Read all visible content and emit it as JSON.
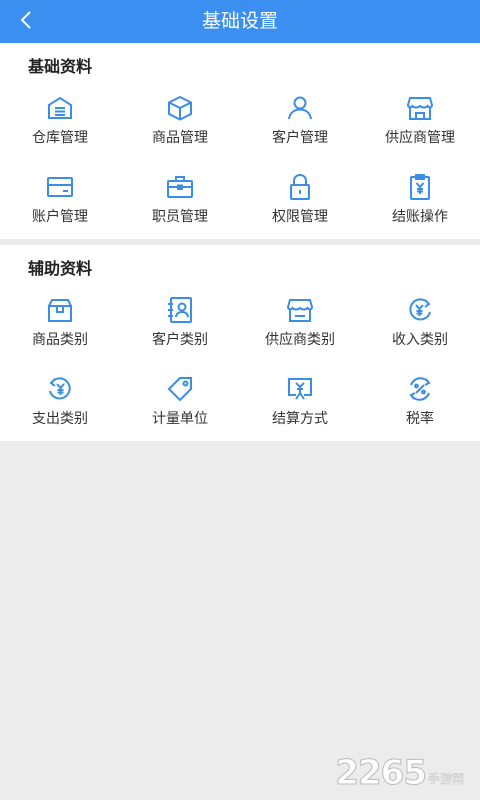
{
  "header": {
    "title": "基础设置",
    "back_icon": "chevron-left-icon"
  },
  "colors": {
    "brand": "#3b8ff0",
    "icon": "#3a8ee6",
    "background": "#ececec"
  },
  "basic_section": {
    "title": "基础资料",
    "items": [
      {
        "label": "仓库管理",
        "icon": "warehouse-icon"
      },
      {
        "label": "商品管理",
        "icon": "box-icon"
      },
      {
        "label": "客户管理",
        "icon": "user-icon"
      },
      {
        "label": "供应商管理",
        "icon": "store-icon"
      },
      {
        "label": "账户管理",
        "icon": "card-icon"
      },
      {
        "label": "职员管理",
        "icon": "briefcase-icon"
      },
      {
        "label": "权限管理",
        "icon": "lock-icon"
      },
      {
        "label": "结账操作",
        "icon": "clipboard-yen-icon"
      }
    ]
  },
  "aux_section": {
    "title": "辅助资料",
    "items": [
      {
        "label": "商品类别",
        "icon": "box-category-icon"
      },
      {
        "label": "客户类别",
        "icon": "contact-book-icon"
      },
      {
        "label": "供应商类别",
        "icon": "store-category-icon"
      },
      {
        "label": "收入类别",
        "icon": "income-icon"
      },
      {
        "label": "支出类别",
        "icon": "expense-icon"
      },
      {
        "label": "计量单位",
        "icon": "tag-icon"
      },
      {
        "label": "结算方式",
        "icon": "settlement-icon"
      },
      {
        "label": "税率",
        "icon": "tax-rate-icon"
      }
    ]
  },
  "watermark": {
    "number": "2265",
    "text": "手游网"
  }
}
